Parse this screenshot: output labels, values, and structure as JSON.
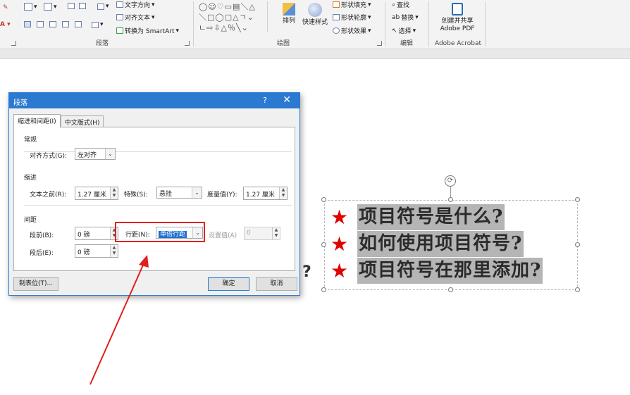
{
  "ribbon": {
    "text_direction": "文字方向",
    "align_text": "对齐文本",
    "convert_smartart": "转换为 SmartArt",
    "paragraph_group": "段落",
    "arrange": "排列",
    "quick_styles": "快速样式",
    "shape_fill": "形状填充",
    "shape_outline": "形状轮廓",
    "shape_effects": "形状效果",
    "drawing_group": "绘图",
    "find": "查找",
    "replace": "替换",
    "select": "选择",
    "editing_group": "编辑",
    "create_share_pdf_line1": "创建并共享",
    "create_share_pdf_line2": "Adobe PDF",
    "acrobat_group": "Adobe Acrobat",
    "shapes_row1": "◯☺♡▭▤＼△",
    "shapes_row2": "＼□◯▢△ㄱ⌄",
    "shapes_row3": "ㄴ⇨⇩△％╲⌄"
  },
  "dialog": {
    "title": "段落",
    "help": "?",
    "close": "✕",
    "tabs": [
      "缩进和间距(I)",
      "中文版式(H)"
    ],
    "general": {
      "section": "常规",
      "alignment_label": "对齐方式(G):",
      "alignment_value": "左对齐"
    },
    "indent": {
      "section": "缩进",
      "before_text_label": "文本之前(R):",
      "before_text_value": "1.27 厘米",
      "special_label": "特殊(S):",
      "special_value": "悬挂",
      "by_label": "度量值(Y):",
      "by_value": "1.27 厘米"
    },
    "spacing": {
      "section": "间距",
      "before_label": "段前(B):",
      "before_value": "0 磅",
      "after_label": "段后(E):",
      "after_value": "0 磅",
      "line_spacing_label": "行距(N):",
      "line_spacing_value": "单倍行距",
      "at_label": "设置值(A)",
      "at_value": "0"
    },
    "tabs_button": "制表位(T)...",
    "ok": "确定",
    "cancel": "取消"
  },
  "slide": {
    "bullets": [
      "项目符号是什么?",
      "如何使用项目符号?",
      "项目符号在那里添加?"
    ],
    "bullet_symbol": "★",
    "stray_mark": "?"
  }
}
